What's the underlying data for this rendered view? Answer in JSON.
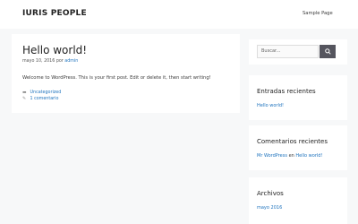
{
  "header": {
    "site_title": "IURIS PEOPLE",
    "nav": [
      "Sample Page"
    ]
  },
  "post": {
    "title": "Hello world!",
    "date": "mayo 10, 2016",
    "by": "por",
    "author": "admin",
    "content": "Welcome to WordPress. This is your first post. Edit or delete it, then start writing!",
    "category": "Uncategorized",
    "comments": "1 comentario"
  },
  "sidebar": {
    "search": {
      "placeholder": "Buscar...",
      "button_icon": "search-icon"
    },
    "recent_posts": {
      "title": "Entradas recientes",
      "items": [
        "Hello world!"
      ]
    },
    "recent_comments": {
      "title": "Comentarios recientes",
      "author": "Mr WordPress",
      "on": "en",
      "post": "Hello world!"
    },
    "archives": {
      "title": "Archivos",
      "items": [
        "mayo 2016"
      ]
    }
  },
  "colors": {
    "background": "#f7f8f9",
    "link": "#1e73be",
    "button": "#55555e"
  }
}
